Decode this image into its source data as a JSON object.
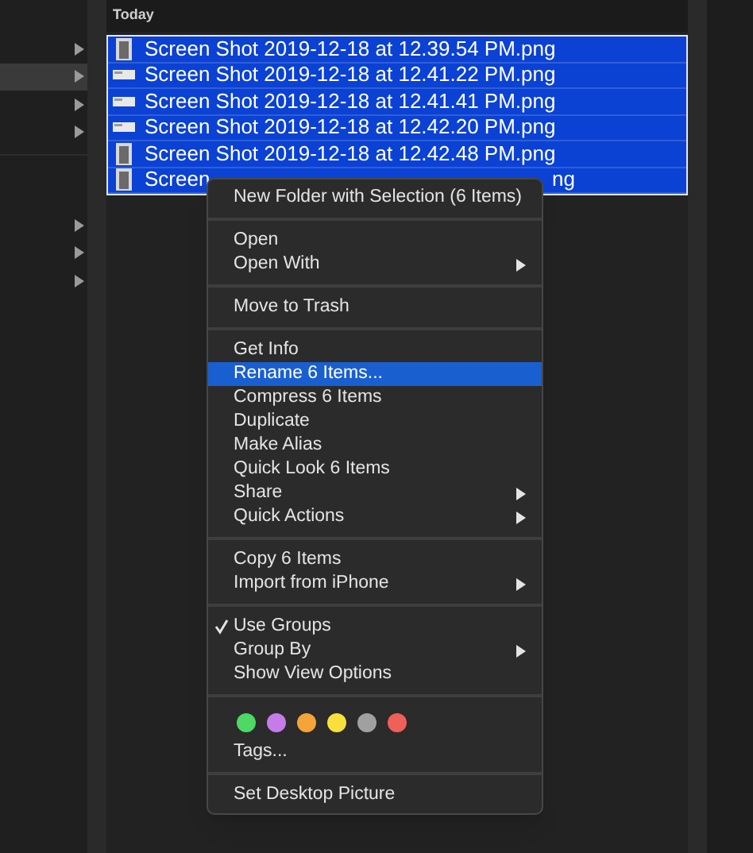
{
  "sidebar": {
    "groups": [
      {
        "rows": [
          {
            "selected": false
          },
          {
            "selected": true
          },
          {
            "selected": false
          },
          {
            "selected": false
          }
        ]
      },
      {
        "rows": [
          {
            "selected": false
          },
          {
            "selected": false
          },
          {
            "selected": false
          }
        ]
      }
    ]
  },
  "file_list": {
    "section_header": "Today",
    "files": [
      {
        "name": "Screen Shot 2019-12-18 at 12.39.54 PM.png",
        "selected": true,
        "kind": "tall"
      },
      {
        "name": "Screen Shot 2019-12-18 at 12.41.22 PM.png",
        "selected": true,
        "kind": "wide"
      },
      {
        "name": "Screen Shot 2019-12-18 at 12.41.41 PM.png",
        "selected": true,
        "kind": "wide"
      },
      {
        "name": "Screen Shot 2019-12-18 at 12.42.20 PM.png",
        "selected": true,
        "kind": "wide"
      },
      {
        "name": "Screen Shot 2019-12-18 at 12.42.48 PM.png",
        "selected": true,
        "kind": "tall"
      },
      {
        "name": "Screen",
        "tail": "ng",
        "selected": true,
        "kind": "tall"
      }
    ]
  },
  "context_menu": {
    "sections": [
      {
        "items": [
          {
            "kind": "text",
            "label": "New Folder with Selection (6 Items)",
            "selected": false,
            "submenu": false
          }
        ]
      },
      {
        "items": [
          {
            "kind": "text",
            "label": "Open",
            "selected": false,
            "submenu": false
          },
          {
            "kind": "text",
            "label": "Open With",
            "selected": false,
            "submenu": true
          }
        ]
      },
      {
        "items": [
          {
            "kind": "text",
            "label": "Move to Trash",
            "selected": false,
            "submenu": false
          }
        ]
      },
      {
        "items": [
          {
            "kind": "text",
            "label": "Get Info",
            "selected": false,
            "submenu": false
          },
          {
            "kind": "text",
            "label": "Rename 6 Items...",
            "selected": true,
            "submenu": false
          },
          {
            "kind": "text",
            "label": "Compress 6 Items",
            "selected": false,
            "submenu": false
          },
          {
            "kind": "text",
            "label": "Duplicate",
            "selected": false,
            "submenu": false
          },
          {
            "kind": "text",
            "label": "Make Alias",
            "selected": false,
            "submenu": false
          },
          {
            "kind": "text",
            "label": "Quick Look 6 Items",
            "selected": false,
            "submenu": false
          },
          {
            "kind": "text",
            "label": "Share",
            "selected": false,
            "submenu": true
          },
          {
            "kind": "text",
            "label": "Quick Actions",
            "selected": false,
            "submenu": true
          }
        ]
      },
      {
        "items": [
          {
            "kind": "text",
            "label": "Copy 6 Items",
            "selected": false,
            "submenu": false
          },
          {
            "kind": "text",
            "label": "Import from iPhone",
            "selected": false,
            "submenu": true
          }
        ]
      },
      {
        "items": [
          {
            "kind": "text",
            "label": "Use Groups",
            "selected": false,
            "submenu": false,
            "checked": true
          },
          {
            "kind": "text",
            "label": "Group By",
            "selected": false,
            "submenu": true,
            "checked": false
          },
          {
            "kind": "text",
            "label": "Show View Options",
            "selected": false,
            "submenu": false,
            "checked": false
          }
        ]
      },
      {
        "items": [
          {
            "kind": "tags",
            "colors": [
              {
                "color": "#4cd964"
              },
              {
                "color": "#c77be8"
              },
              {
                "color": "#f5a43a"
              },
              {
                "color": "#f7e03c"
              },
              {
                "color": "#a0a0a0"
              },
              {
                "color": "#f0605a"
              }
            ]
          },
          {
            "kind": "text",
            "label": "Tags...",
            "selected": false,
            "submenu": false
          }
        ]
      },
      {
        "items": [
          {
            "kind": "text",
            "label": "Set Desktop Picture",
            "selected": false,
            "submenu": false
          }
        ]
      }
    ]
  }
}
